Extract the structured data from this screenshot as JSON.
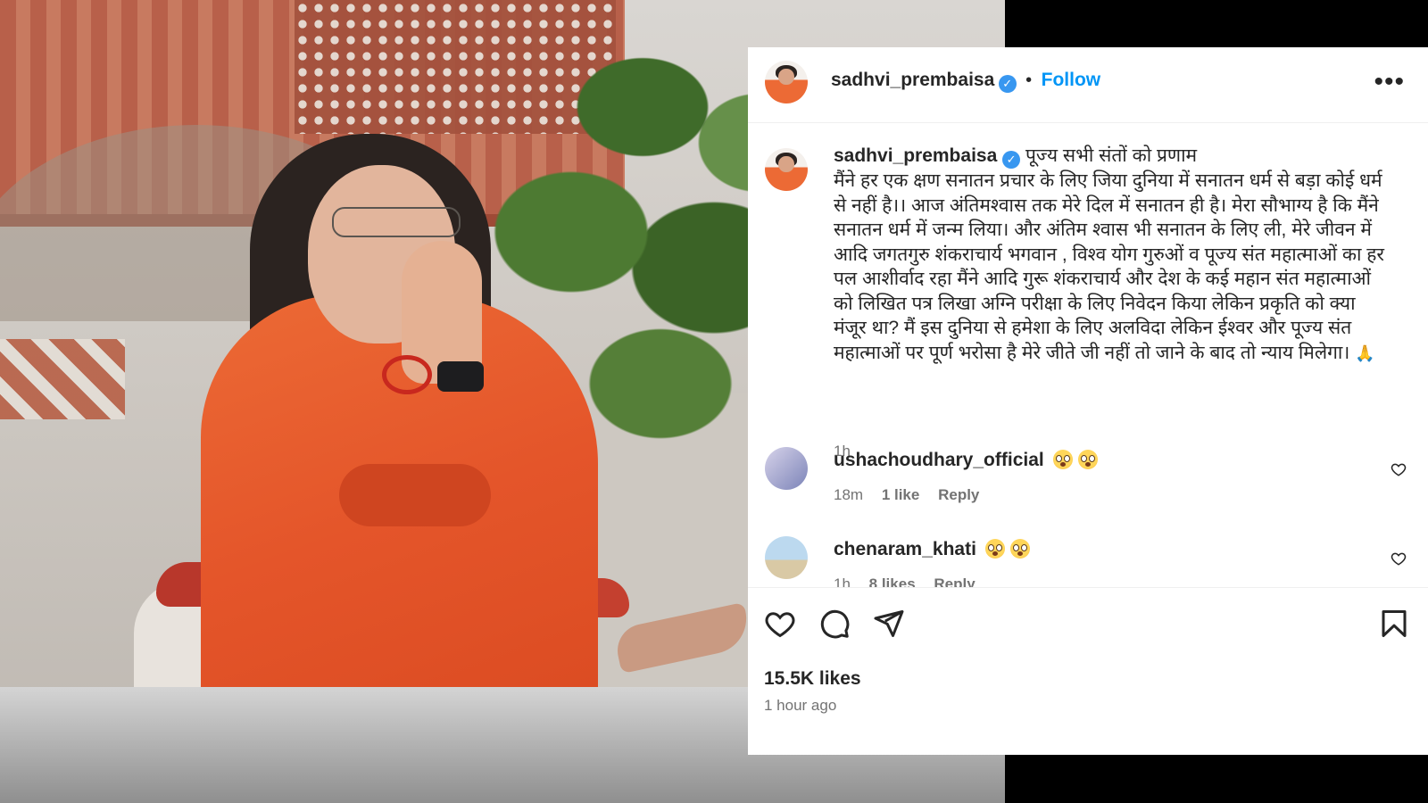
{
  "post": {
    "author": "sadhvi_prembaisa",
    "verified_badge": "verified-badge-icon",
    "separator": "•",
    "follow_label": "Follow",
    "more_label": "•••",
    "caption_first_line": "पूज्य सभी संतों को प्रणाम",
    "caption_body": "मैंने हर एक क्षण सनातन प्रचार के लिए जिया दुनिया में सनातन धर्म से बड़ा कोई धर्म से नहीं है।। आज अंतिमश्वास तक मेरे दिल में सनातन ही है। मेरा सौभाग्य है कि मैंने सनातन धर्म में जन्म लिया। और अंतिम श्वास भी सनातन के लिए ली, मेरे जीवन में आदि जगतगुरु शंकराचार्य भगवान , विश्व योग गुरुओं व पूज्य संत महात्माओं का हर पल आशीर्वाद रहा मैंने आदि गुरू शंकराचार्य और देश के कई महान संत महात्माओं को लिखित पत्र लिखा अग्नि परीक्षा के लिए निवेदन किया लेकिन प्रकृति को क्या मंजूर था? मैं इस दुनिया से हमेशा के लिए अलविदा लेकिन ईश्वर और पूज्य संत महात्माओं पर पूर्ण भरोसा है मेरे जीते जी नहीं तो जाने के बाद तो न्याय मिलेगा।",
    "caption_emoji": "🙏",
    "caption_time": "1h"
  },
  "comments": [
    {
      "user": "ushachoudhary_official",
      "emojis": "😳 😳",
      "time": "18m",
      "likes": "1 like",
      "reply_label": "Reply"
    },
    {
      "user": "chenaram_khati",
      "emojis": "😳 😳",
      "time": "1h",
      "likes": "8 likes",
      "reply_label": "Reply"
    }
  ],
  "actions": {
    "like_icon": "heart-icon",
    "comment_icon": "comment-icon",
    "share_icon": "share-icon",
    "save_icon": "bookmark-icon",
    "likes_count": "15.5K likes",
    "posted": "1 hour ago"
  },
  "colors": {
    "follow_blue": "#0095f6",
    "verified_blue": "#3897f0",
    "robe_orange": "#e4552a"
  }
}
